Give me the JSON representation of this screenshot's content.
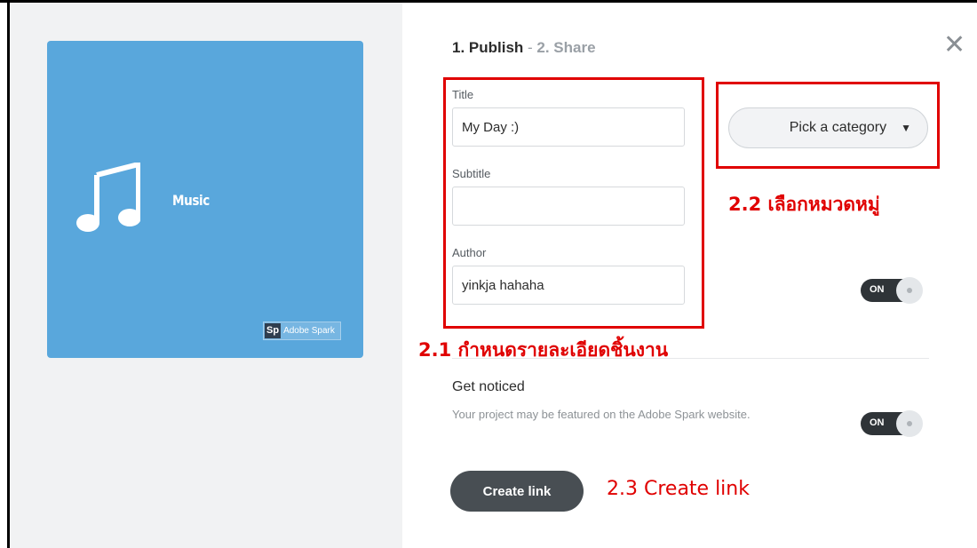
{
  "cover": {
    "title": "Music",
    "brand_badge": "Sp",
    "brand_text": "Adobe Spark",
    "background": "#59a7dc",
    "icon": "music-note-icon"
  },
  "header": {
    "step1": "1. Publish",
    "separator": " - ",
    "step2": "2. Share",
    "close_icon": "close-icon"
  },
  "form": {
    "title_label": "Title",
    "title_value": "My Day :)",
    "subtitle_label": "Subtitle",
    "subtitle_value": "",
    "author_label": "Author",
    "author_value": "yinkja hahaha"
  },
  "category": {
    "label": "Pick a category",
    "caret": "▼"
  },
  "toggles": {
    "author_toggle_label": "ON",
    "get_noticed_toggle_label": "ON"
  },
  "get_noticed": {
    "title": "Get noticed",
    "description": "Your project may be featured on the Adobe Spark website."
  },
  "actions": {
    "create_link": "Create link"
  },
  "annotations": {
    "a21": "2.1 กำหนดรายละเอียดชิ้นงาน",
    "a22": "2.2 เลือกหมวดหมู่",
    "a23": "2.3 Create link",
    "color": "#e00000"
  }
}
